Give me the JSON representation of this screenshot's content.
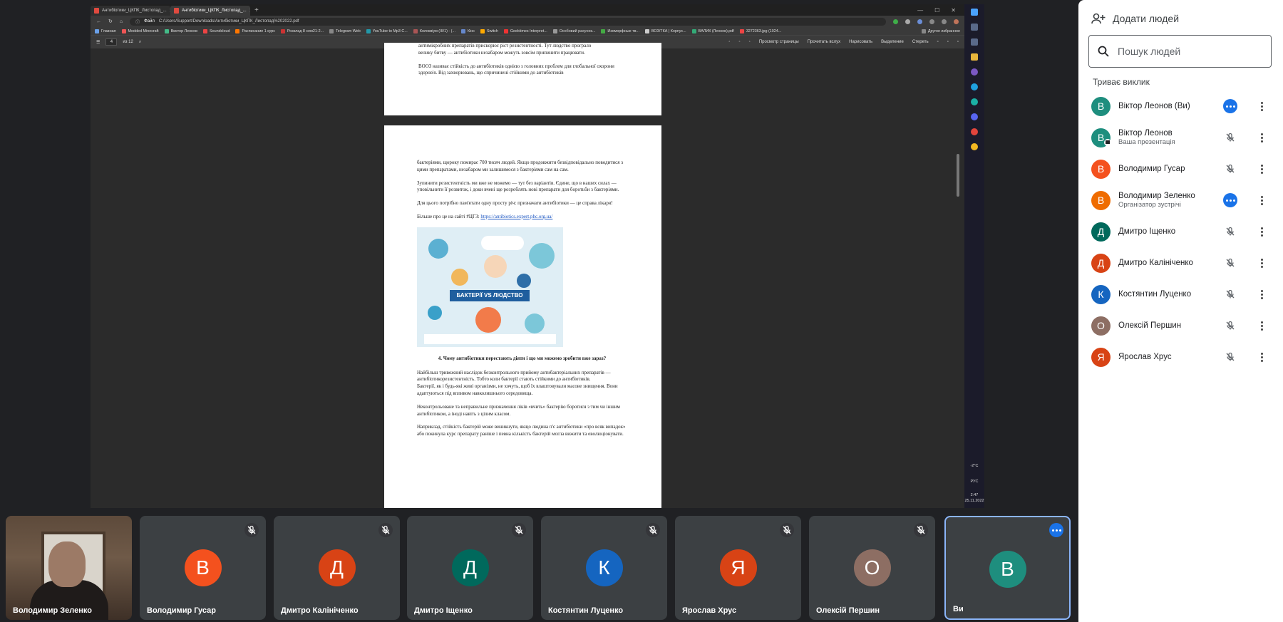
{
  "browser": {
    "tabs": [
      {
        "label": "Антибіотики_ЦКПК_Листопад_..."
      },
      {
        "label": "Антибіотики_ЦКПК_Листопад_..."
      }
    ],
    "address_label": "Файл",
    "url": "C:/Users/Support/Downloads/Антибіотики_ЦКПК_Листопад%202022.pdf",
    "bookmarks": [
      "Главная",
      "Modded Minecraft",
      "Виктор Леонов",
      "Soundcloud",
      "Расписание 1 курс",
      "Розклад 8 сем21-2...",
      "Telegram Web",
      "YouTube to Mp3 C...",
      "Колоквіум (ІІІ/1) - (...",
      "Кінс",
      "Switch",
      "Geektimes Interpret...",
      "Особовий рахунок...",
      "Изоморфные тв...",
      "ВОЗ/ТКА | Корпус...",
      "BAЛИК (Леонов).pdf",
      "3272363.jpg (1024...",
      "Другое избранное"
    ]
  },
  "pdf_toolbar": {
    "page": "4",
    "page_total": "из 12",
    "items": [
      "Просмотр страницы",
      "Прочитать вслух",
      "Нарисовать",
      "Выделение",
      "Стереть"
    ]
  },
  "pdf": {
    "page1": [
      "антимікробних препаратів прискорює ріст резистентності. Тут людство програло",
      "велику битву — антибіотики незабаром можуть зовсім припинити працювати.",
      "ВООЗ називає стійкість до антибіотиків однією з головних проблем для глобальної охорони здоров'я. Від захворювань, що спричинені стійкими до антибіотиків"
    ],
    "page2": {
      "p1": "бактеріями, щороку помирає 700 тисяч людей. Якщо продовжити безвідповідально поводитися з цими препаратами, незабаром ми залишимося з бактеріями сам на сам.",
      "p2": "Зупинити резистентність ми вже не можемо — тут без варіантів. Єдине, що в наших силах — уповільнити її розвиток, і доки вчені ще розроблять нові препарати для боротьби з бактеріями.",
      "p3": "Для цього потрібно пам'ятати одну просту річ: призначати антибіотики — це справа лікаря!",
      "p4_prefix": "Більше про це на сайті #ЦГЗ: ",
      "p4_link": "https://antibiotics.expert.phc.org.ua/",
      "poster_label": "БАКТЕРІЇ VS ЛЮДСТВО",
      "heading": "4.   Чому антибіотики перестають діяти і що ми можемо зробити вже зараз?",
      "p5": "Найбільш тривожний наслідок безконтрольного прийому антибактеріальних препаратів — антибіотикорезистентність. Тобто коли бактерії стають стійкими до антибіотиків.",
      "p6": "Бактерії, як і будь-які живі організми, не хочуть, щоб їх влаштовували масове знищення. Вони адаптуються під впливом навколишнього середовища.",
      "p7": "Неконтрольоване та неправильне призначення ліків «вчить» бактерію боротися з тим чи іншим антибіотиком, а іноді навіть з цілим класом.",
      "p8": "Наприклад, стійкість бактерій може виникнути, якщо людина п'є антибіотики «про всяк випадок» або покинула курс препарату раніше і певна кількість бактерій могла вижити та еволюціонувати."
    }
  },
  "taskbar": {
    "weather": "-2°C",
    "lang": "РУС",
    "time": "2:47",
    "date": "25.11.2022"
  },
  "people_panel": {
    "add_people": "Додати людей",
    "search_placeholder": "Пошук людей",
    "section": "Триває виклик",
    "participants": [
      {
        "initial": "В",
        "name": "Віктор Леонов (Ви)",
        "sub": "",
        "color": "#1e8e7e",
        "status": "more"
      },
      {
        "initial": "В",
        "name": "Віктор Леонов",
        "sub": "Ваша презентація",
        "color": "#1e8e7e",
        "status": "mic-off-loud"
      },
      {
        "initial": "В",
        "name": "Володимир Гусар",
        "sub": "",
        "color": "#f4511e",
        "status": "mic-off"
      },
      {
        "initial": "В",
        "name": "Володимир Зеленко",
        "sub": "Організатор зустрічі",
        "color": "#ef6c00",
        "status": "more"
      },
      {
        "initial": "Д",
        "name": "Дмитро Іщенко",
        "sub": "",
        "color": "#00695c",
        "status": "mic-off"
      },
      {
        "initial": "Д",
        "name": "Дмитро Калініченко",
        "sub": "",
        "color": "#d84315",
        "status": "mic-off"
      },
      {
        "initial": "К",
        "name": "Костянтин Луценко",
        "sub": "",
        "color": "#1565c0",
        "status": "mic-off"
      },
      {
        "initial": "О",
        "name": "Олексій Першин",
        "sub": "",
        "color": "#8d6e63",
        "status": "mic-off"
      },
      {
        "initial": "Я",
        "name": "Ярослав Хрус",
        "sub": "",
        "color": "#d84315",
        "status": "mic-off"
      }
    ]
  },
  "tiles": [
    {
      "name": "Володимир Зеленко",
      "initial": "",
      "color": "",
      "kind": "video"
    },
    {
      "name": "Володимир Гусар",
      "initial": "В",
      "color": "#f4511e",
      "kind": "muted"
    },
    {
      "name": "Дмитро Калініченко",
      "initial": "Д",
      "color": "#d84315",
      "kind": "muted"
    },
    {
      "name": "Дмитро Іщенко",
      "initial": "Д",
      "color": "#00695c",
      "kind": "muted"
    },
    {
      "name": "Костянтин Луценко",
      "initial": "К",
      "color": "#1565c0",
      "kind": "muted"
    },
    {
      "name": "Ярослав Хрус",
      "initial": "Я",
      "color": "#d84315",
      "kind": "muted"
    },
    {
      "name": "Олексій Першин",
      "initial": "О",
      "color": "#8d6e63",
      "kind": "muted"
    },
    {
      "name": "Ви",
      "initial": "В",
      "color": "#1e8e7e",
      "kind": "self"
    }
  ]
}
